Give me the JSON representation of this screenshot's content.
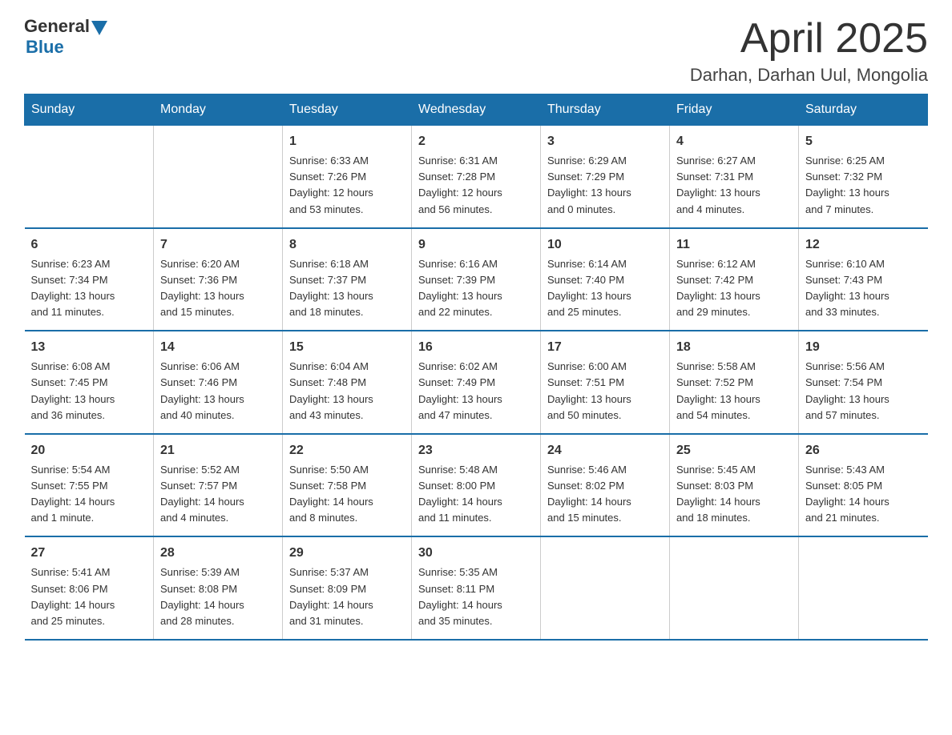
{
  "header": {
    "logo_general": "General",
    "logo_blue": "Blue",
    "month_title": "April 2025",
    "location": "Darhan, Darhan Uul, Mongolia"
  },
  "weekdays": [
    "Sunday",
    "Monday",
    "Tuesday",
    "Wednesday",
    "Thursday",
    "Friday",
    "Saturday"
  ],
  "weeks": [
    [
      {
        "day": "",
        "info": ""
      },
      {
        "day": "",
        "info": ""
      },
      {
        "day": "1",
        "info": "Sunrise: 6:33 AM\nSunset: 7:26 PM\nDaylight: 12 hours\nand 53 minutes."
      },
      {
        "day": "2",
        "info": "Sunrise: 6:31 AM\nSunset: 7:28 PM\nDaylight: 12 hours\nand 56 minutes."
      },
      {
        "day": "3",
        "info": "Sunrise: 6:29 AM\nSunset: 7:29 PM\nDaylight: 13 hours\nand 0 minutes."
      },
      {
        "day": "4",
        "info": "Sunrise: 6:27 AM\nSunset: 7:31 PM\nDaylight: 13 hours\nand 4 minutes."
      },
      {
        "day": "5",
        "info": "Sunrise: 6:25 AM\nSunset: 7:32 PM\nDaylight: 13 hours\nand 7 minutes."
      }
    ],
    [
      {
        "day": "6",
        "info": "Sunrise: 6:23 AM\nSunset: 7:34 PM\nDaylight: 13 hours\nand 11 minutes."
      },
      {
        "day": "7",
        "info": "Sunrise: 6:20 AM\nSunset: 7:36 PM\nDaylight: 13 hours\nand 15 minutes."
      },
      {
        "day": "8",
        "info": "Sunrise: 6:18 AM\nSunset: 7:37 PM\nDaylight: 13 hours\nand 18 minutes."
      },
      {
        "day": "9",
        "info": "Sunrise: 6:16 AM\nSunset: 7:39 PM\nDaylight: 13 hours\nand 22 minutes."
      },
      {
        "day": "10",
        "info": "Sunrise: 6:14 AM\nSunset: 7:40 PM\nDaylight: 13 hours\nand 25 minutes."
      },
      {
        "day": "11",
        "info": "Sunrise: 6:12 AM\nSunset: 7:42 PM\nDaylight: 13 hours\nand 29 minutes."
      },
      {
        "day": "12",
        "info": "Sunrise: 6:10 AM\nSunset: 7:43 PM\nDaylight: 13 hours\nand 33 minutes."
      }
    ],
    [
      {
        "day": "13",
        "info": "Sunrise: 6:08 AM\nSunset: 7:45 PM\nDaylight: 13 hours\nand 36 minutes."
      },
      {
        "day": "14",
        "info": "Sunrise: 6:06 AM\nSunset: 7:46 PM\nDaylight: 13 hours\nand 40 minutes."
      },
      {
        "day": "15",
        "info": "Sunrise: 6:04 AM\nSunset: 7:48 PM\nDaylight: 13 hours\nand 43 minutes."
      },
      {
        "day": "16",
        "info": "Sunrise: 6:02 AM\nSunset: 7:49 PM\nDaylight: 13 hours\nand 47 minutes."
      },
      {
        "day": "17",
        "info": "Sunrise: 6:00 AM\nSunset: 7:51 PM\nDaylight: 13 hours\nand 50 minutes."
      },
      {
        "day": "18",
        "info": "Sunrise: 5:58 AM\nSunset: 7:52 PM\nDaylight: 13 hours\nand 54 minutes."
      },
      {
        "day": "19",
        "info": "Sunrise: 5:56 AM\nSunset: 7:54 PM\nDaylight: 13 hours\nand 57 minutes."
      }
    ],
    [
      {
        "day": "20",
        "info": "Sunrise: 5:54 AM\nSunset: 7:55 PM\nDaylight: 14 hours\nand 1 minute."
      },
      {
        "day": "21",
        "info": "Sunrise: 5:52 AM\nSunset: 7:57 PM\nDaylight: 14 hours\nand 4 minutes."
      },
      {
        "day": "22",
        "info": "Sunrise: 5:50 AM\nSunset: 7:58 PM\nDaylight: 14 hours\nand 8 minutes."
      },
      {
        "day": "23",
        "info": "Sunrise: 5:48 AM\nSunset: 8:00 PM\nDaylight: 14 hours\nand 11 minutes."
      },
      {
        "day": "24",
        "info": "Sunrise: 5:46 AM\nSunset: 8:02 PM\nDaylight: 14 hours\nand 15 minutes."
      },
      {
        "day": "25",
        "info": "Sunrise: 5:45 AM\nSunset: 8:03 PM\nDaylight: 14 hours\nand 18 minutes."
      },
      {
        "day": "26",
        "info": "Sunrise: 5:43 AM\nSunset: 8:05 PM\nDaylight: 14 hours\nand 21 minutes."
      }
    ],
    [
      {
        "day": "27",
        "info": "Sunrise: 5:41 AM\nSunset: 8:06 PM\nDaylight: 14 hours\nand 25 minutes."
      },
      {
        "day": "28",
        "info": "Sunrise: 5:39 AM\nSunset: 8:08 PM\nDaylight: 14 hours\nand 28 minutes."
      },
      {
        "day": "29",
        "info": "Sunrise: 5:37 AM\nSunset: 8:09 PM\nDaylight: 14 hours\nand 31 minutes."
      },
      {
        "day": "30",
        "info": "Sunrise: 5:35 AM\nSunset: 8:11 PM\nDaylight: 14 hours\nand 35 minutes."
      },
      {
        "day": "",
        "info": ""
      },
      {
        "day": "",
        "info": ""
      },
      {
        "day": "",
        "info": ""
      }
    ]
  ]
}
